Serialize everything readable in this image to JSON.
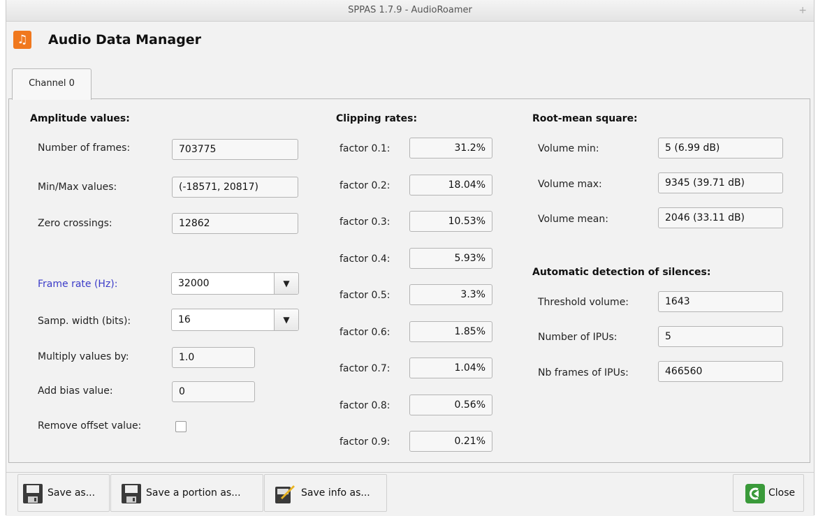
{
  "window": {
    "title": "SPPAS 1.7.9 - AudioRoamer",
    "pin_glyph": "+"
  },
  "app": {
    "title": "Audio Data Manager",
    "icon": "music-note-icon",
    "icon_glyph": "♫",
    "icon_color": "#f0781e"
  },
  "tabs": [
    {
      "label": "Channel 0",
      "selected": true
    }
  ],
  "amplitude": {
    "heading": "Amplitude values:",
    "frames_label": "Number of frames:",
    "frames_value": "703775",
    "minmax_label": "Min/Max values:",
    "minmax_value": "(-18571, 20817)",
    "zero_label": "Zero crossings:",
    "zero_value": "12862",
    "framerate_label": "Frame rate (Hz):",
    "framerate_value": "32000",
    "sampwidth_label": "Samp. width (bits):",
    "sampwidth_value": "16",
    "multiply_label": "Multiply values by:",
    "multiply_value": "1.0",
    "bias_label": "Add bias value:",
    "bias_value": "0",
    "offset_label": "Remove offset value:",
    "offset_checked": false,
    "dropdown_glyph": "▼"
  },
  "clipping": {
    "heading": "Clipping rates:",
    "rows": [
      {
        "label": "factor 0.1:",
        "value": "31.2%"
      },
      {
        "label": "factor 0.2:",
        "value": "18.04%"
      },
      {
        "label": "factor 0.3:",
        "value": "10.53%"
      },
      {
        "label": "factor 0.4:",
        "value": "5.93%"
      },
      {
        "label": "factor 0.5:",
        "value": "3.3%"
      },
      {
        "label": "factor 0.6:",
        "value": "1.85%"
      },
      {
        "label": "factor 0.7:",
        "value": "1.04%"
      },
      {
        "label": "factor 0.8:",
        "value": "0.56%"
      },
      {
        "label": "factor 0.9:",
        "value": "0.21%"
      }
    ]
  },
  "rms": {
    "heading": "Root-mean square:",
    "min_label": "Volume min:",
    "min_value": "5 (6.99 dB)",
    "max_label": "Volume max:",
    "max_value": "9345 (39.71 dB)",
    "mean_label": "Volume mean:",
    "mean_value": "2046 (33.11 dB)"
  },
  "silences": {
    "heading": "Automatic detection of silences:",
    "threshold_label": "Threshold volume:",
    "threshold_value": "1643",
    "ipus_label": "Number of IPUs:",
    "ipus_value": "5",
    "nbframes_label": "Nb frames of IPUs:",
    "nbframes_value": "466560"
  },
  "toolbar": {
    "save_as": "Save as...",
    "save_portion": "Save a portion as...",
    "save_info": "Save info as...",
    "close": "Close",
    "close_color": "#3a9a3a"
  }
}
